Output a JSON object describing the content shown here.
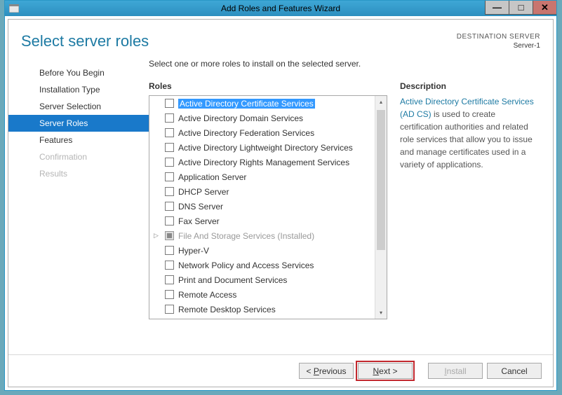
{
  "window": {
    "title": "Add Roles and Features Wizard"
  },
  "page": {
    "title": "Select server roles",
    "destination_label": "DESTINATION SERVER",
    "destination_name": "Server-1"
  },
  "sidebar": {
    "items": [
      {
        "label": "Before You Begin",
        "state": "normal"
      },
      {
        "label": "Installation Type",
        "state": "normal"
      },
      {
        "label": "Server Selection",
        "state": "normal"
      },
      {
        "label": "Server Roles",
        "state": "active"
      },
      {
        "label": "Features",
        "state": "normal"
      },
      {
        "label": "Confirmation",
        "state": "disabled"
      },
      {
        "label": "Results",
        "state": "disabled"
      }
    ]
  },
  "main": {
    "instruction": "Select one or more roles to install on the selected server.",
    "roles_label": "Roles",
    "roles": [
      {
        "label": "Active Directory Certificate Services",
        "selected": true
      },
      {
        "label": "Active Directory Domain Services"
      },
      {
        "label": "Active Directory Federation Services"
      },
      {
        "label": "Active Directory Lightweight Directory Services"
      },
      {
        "label": "Active Directory Rights Management Services"
      },
      {
        "label": "Application Server"
      },
      {
        "label": "DHCP Server"
      },
      {
        "label": "DNS Server"
      },
      {
        "label": "Fax Server"
      },
      {
        "label": "File And Storage Services (Installed)",
        "installed": true,
        "expandable": true
      },
      {
        "label": "Hyper-V"
      },
      {
        "label": "Network Policy and Access Services"
      },
      {
        "label": "Print and Document Services"
      },
      {
        "label": "Remote Access"
      },
      {
        "label": "Remote Desktop Services"
      }
    ],
    "description_label": "Description",
    "description_link": "Active Directory Certificate Services (AD CS)",
    "description_rest": " is used to create certification authorities and related role services that allow you to issue and manage certificates used in a variety of applications."
  },
  "footer": {
    "previous": "< Previous",
    "next": "Next >",
    "install": "Install",
    "cancel": "Cancel"
  }
}
